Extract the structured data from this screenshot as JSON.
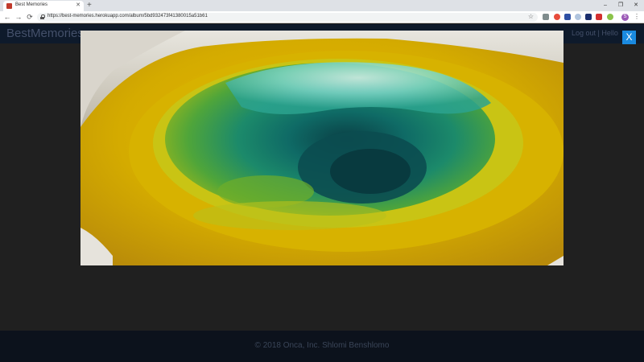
{
  "browser": {
    "tab": {
      "title": "Best Memories",
      "close_icon": "close-icon"
    },
    "new_tab_label": "+",
    "window_controls": {
      "minimize": "–",
      "maximize": "❐",
      "close": "✕"
    },
    "nav": {
      "back": "←",
      "forward": "→",
      "reload": "⟳"
    },
    "url": "https://best-memories.herokuapp.com/album/5bd932473f41380015a51b61",
    "profile_initial": "S"
  },
  "app": {
    "brand": "BestMemories",
    "nav_links": "Log out | Hello",
    "footer": "© 2018 Onca, Inc. Shlomi Benshlomo"
  },
  "lightbox": {
    "close_label": "X",
    "image": "hot-spring-photo"
  },
  "colors": {
    "close_button": "#1a8ae0",
    "overlay": "#202020"
  }
}
